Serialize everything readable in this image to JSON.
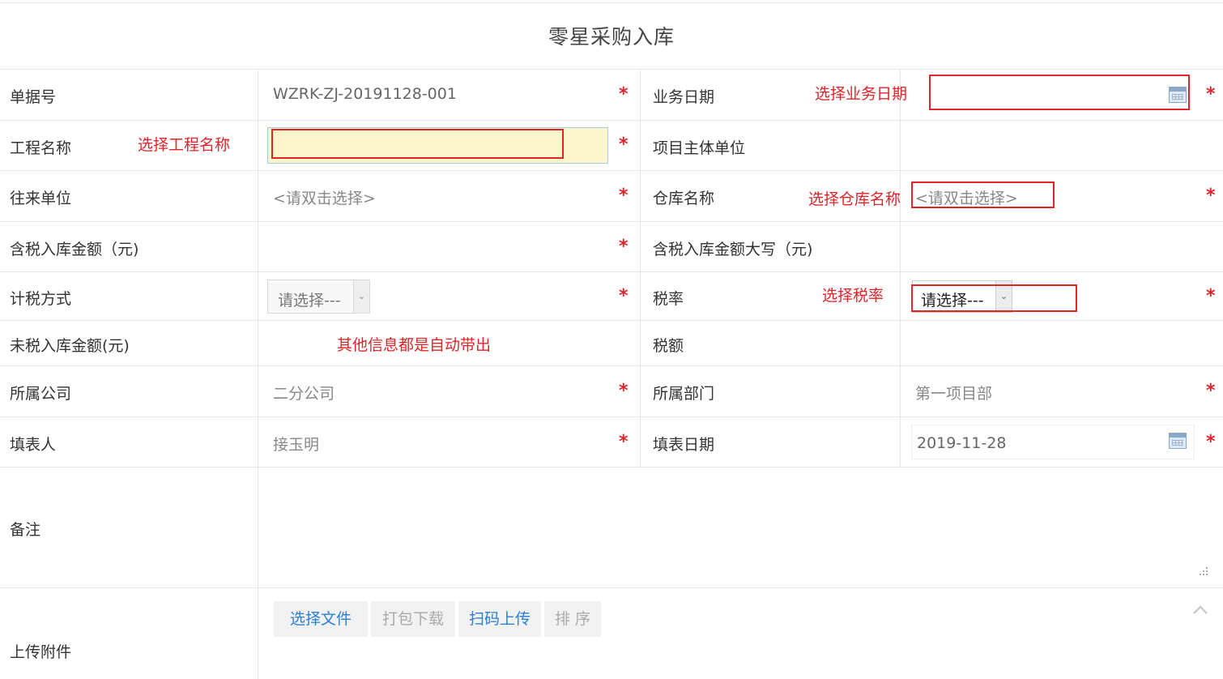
{
  "page": {
    "title": "零星采购入库"
  },
  "form": {
    "doc_no": {
      "label": "单据号",
      "value": "WZRK-ZJ-20191128-001"
    },
    "biz_date": {
      "label": "业务日期",
      "value": ""
    },
    "project_name": {
      "label": "工程名称",
      "value": ""
    },
    "project_owner": {
      "label": "项目主体单位",
      "value": ""
    },
    "partner": {
      "label": "往来单位",
      "placeholder": "<请双击选择>"
    },
    "warehouse": {
      "label": "仓库名称",
      "placeholder": "<请双击选择>"
    },
    "amount_tax": {
      "label": "含税入库金额（元)",
      "value": ""
    },
    "amount_tax_upper": {
      "label": "含税入库金额大写（元)",
      "value": ""
    },
    "tax_method": {
      "label": "计税方式",
      "selected": "请选择---"
    },
    "tax_rate": {
      "label": "税率",
      "selected": "请选择---"
    },
    "amount_notax": {
      "label": "未税入库金额(元)",
      "value": ""
    },
    "tax_amount": {
      "label": "税额",
      "value": ""
    },
    "company": {
      "label": "所属公司",
      "value": "二分公司"
    },
    "department": {
      "label": "所属部门",
      "value": "第一项目部"
    },
    "filler": {
      "label": "填表人",
      "value": "接玉明"
    },
    "fill_date": {
      "label": "填表日期",
      "value": "2019-11-28"
    },
    "remark": {
      "label": "备注",
      "value": ""
    },
    "attachments": {
      "label": "上传附件"
    }
  },
  "required_mark": "*",
  "buttons": {
    "select_file": "选择文件",
    "pack_download": "打包下载",
    "scan_upload": "扫码上传",
    "sort": "排 序"
  },
  "annotations": {
    "biz_date": "选择业务日期",
    "project_name": "选择工程名称",
    "warehouse": "选择仓库名称",
    "tax_rate": "选择税率",
    "auto_info": "其他信息都是自动带出"
  },
  "icons": {
    "calendar": "calendar-icon",
    "dropdown": "chevron-down-icon",
    "resize": "resize-handle-icon",
    "collapse": "chevron-up-icon"
  },
  "colors": {
    "required": "#e0242a",
    "annotation": "#e0242a",
    "link_button": "#2a7fd4",
    "highlight_input": "#fdf5cc"
  }
}
